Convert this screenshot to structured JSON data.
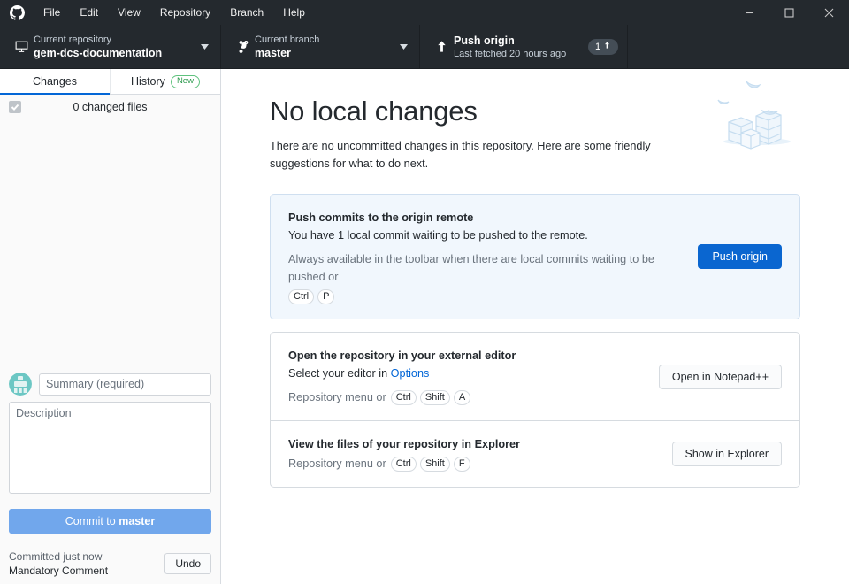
{
  "window": {
    "menu_items": [
      "File",
      "Edit",
      "View",
      "Repository",
      "Branch",
      "Help"
    ],
    "logo_icon": "github-logo-icon",
    "controls": {
      "minimize": "minimize-icon",
      "maximize": "maximize-icon",
      "close": "close-icon"
    }
  },
  "toolbar": {
    "repository": {
      "icon": "desktop-monitor-icon",
      "label": "Current repository",
      "value": "gem-dcs-documentation",
      "caret": "chevron-down-icon"
    },
    "branch": {
      "icon": "git-branch-icon",
      "label": "Current branch",
      "value": "master",
      "caret": "chevron-down-icon"
    },
    "push": {
      "icon": "arrow-up-icon",
      "label": "Push origin",
      "value": "Last fetched 20 hours ago",
      "badge_count": "1",
      "badge_icon": "arrow-up-icon"
    }
  },
  "sidebar": {
    "tabs": [
      {
        "label": "Changes",
        "active": true
      },
      {
        "label": "History",
        "active": false,
        "badge": "New"
      }
    ],
    "changed_files_label": "0 changed files",
    "checkbox_icon": "checkmark-icon",
    "commit_form": {
      "avatar": "user-identicon-avatar",
      "summary_placeholder": "Summary (required)",
      "summary_value": "",
      "description_placeholder": "Description",
      "description_value": "",
      "commit_button_prefix": "Commit to ",
      "commit_button_branch": "master"
    },
    "commit_footer": {
      "status": "Committed just now",
      "message": "Mandatory Comment",
      "undo_label": "Undo"
    }
  },
  "main": {
    "title": "No local changes",
    "subtitle": "There are no uncommitted changes in this repository. Here are some friendly suggestions for what to do next.",
    "illustration": "boxes-and-birds-illustration",
    "cards": [
      {
        "title": "Push commits to the origin remote",
        "description": "You have 1 local commit waiting to be pushed to the remote.",
        "hint_text": "Always available in the toolbar when there are local commits waiting to be pushed or",
        "hint_keys": [
          "Ctrl",
          "P"
        ],
        "button_label": "Push origin",
        "button_style": "primary"
      },
      {
        "title": "Open the repository in your external editor",
        "description_prefix": "Select your editor in ",
        "description_link": "Options",
        "hint_text": "Repository menu or",
        "hint_keys": [
          "Ctrl",
          "Shift",
          "A"
        ],
        "button_label": "Open in Notepad++",
        "button_style": "default"
      },
      {
        "title": "View the files of your repository in Explorer",
        "hint_text": "Repository menu or",
        "hint_keys": [
          "Ctrl",
          "Shift",
          "F"
        ],
        "button_label": "Show in Explorer",
        "button_style": "default"
      }
    ]
  },
  "colors": {
    "toolbar_bg": "#24292e",
    "accent_blue": "#0366d6",
    "primary_button": "#0a66d0",
    "commit_button": "#71a7ec",
    "card_blue_bg": "#f1f7fd",
    "badge_green": "#2d9a4e",
    "avatar_teal": "#6cc7c4"
  }
}
